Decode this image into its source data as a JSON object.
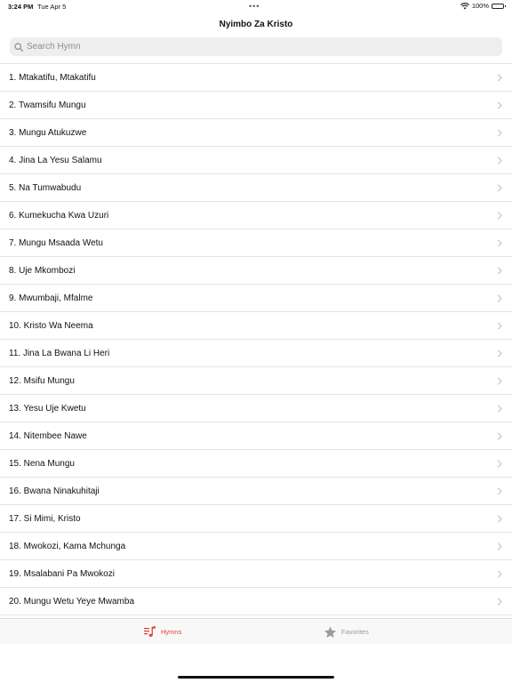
{
  "status_bar": {
    "time": "3:24 PM",
    "date": "Tue Apr 5",
    "battery": "100%",
    "icons": [
      "wifi-icon",
      "battery-icon"
    ]
  },
  "nav": {
    "title": "Nyimbo Za Kristo"
  },
  "search": {
    "placeholder": "Search Hymn",
    "value": ""
  },
  "hymns": [
    "1. Mtakatifu, Mtakatifu",
    "2. Twamsifu Mungu",
    "3. Mungu Atukuzwe",
    "4. Jina La Yesu Salamu",
    "5. Na Tumwabudu",
    "6. Kumekucha Kwa Uzuri",
    "7. Mungu Msaada Wetu",
    "8. Uje Mkombozi",
    "9. Mwumbaji, Mfalme",
    "10. Kristo Wa Neema",
    "11. Jina La Bwana Li Heri",
    "12. Msifu Mungu",
    "13. Yesu Uje Kwetu",
    "14. Nitembee Nawe",
    "15. Nena Mungu",
    "16. Bwana Ninakuhitaji",
    "17. Si Mimi, Kristo",
    "18. Mwokozi, Kama Mchunga",
    "19. Msalabani Pa Mwokozi",
    "20. Mungu Wetu Yeye Mwamba"
  ],
  "tabs": {
    "hymns": "Hymns",
    "favorites": "Favorites"
  },
  "colors": {
    "accent": "#e0453a",
    "inactive": "#9a9aa0",
    "separator": "#e4e4e6",
    "search_bg": "#eeeeef"
  }
}
